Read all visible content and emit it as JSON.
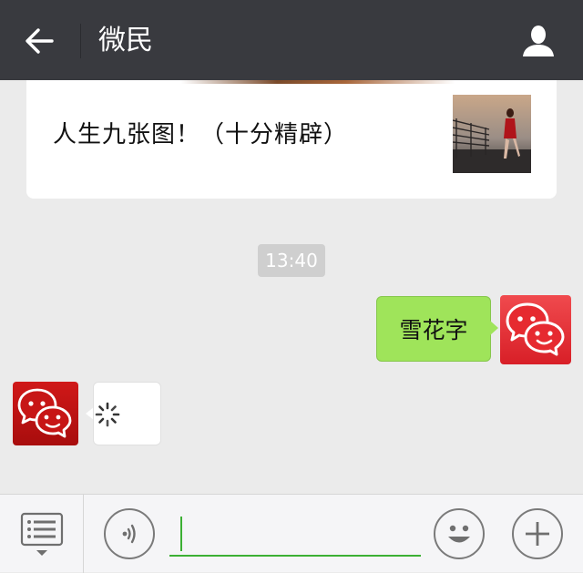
{
  "header": {
    "title": "微民",
    "back_icon": "arrow-left-icon",
    "profile_icon": "person-icon",
    "background": "#393a3f"
  },
  "article": {
    "title": "人生九张图！（十分精辟）",
    "thumbnail": "photo-thumbnail"
  },
  "messages": {
    "timestamp": "13:40",
    "sent": {
      "text": "雪花字",
      "bubble_color": "#9fe45a"
    },
    "received": {
      "status": "loading"
    }
  },
  "input_bar": {
    "menu_icon": "list-menu-icon",
    "voice_icon": "voice-icon",
    "emoji_icon": "emoji-icon",
    "plus_icon": "plus-icon",
    "input_value": "",
    "accent": "#3cb034"
  }
}
